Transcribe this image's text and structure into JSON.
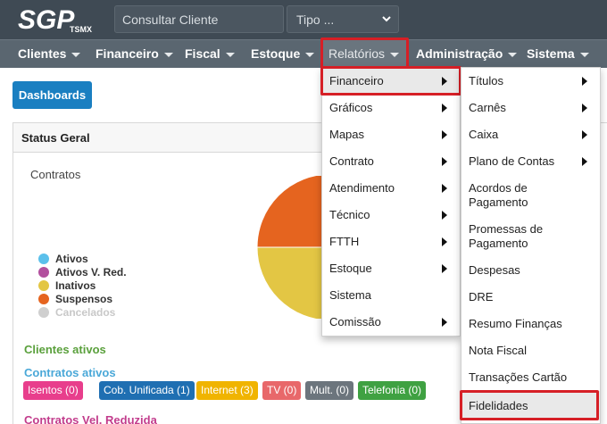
{
  "header": {
    "logo_text": "SGP",
    "logo_sub": "TSMX",
    "search_placeholder": "Consultar Cliente",
    "type_select_value": "Tipo ..."
  },
  "nav": [
    {
      "label": "Clientes"
    },
    {
      "label": "Financeiro"
    },
    {
      "label": "Fiscal"
    },
    {
      "label": "Estoque"
    },
    {
      "label": "Relatórios",
      "active": true
    },
    {
      "label": "Administração"
    },
    {
      "label": "Sistema"
    }
  ],
  "content": {
    "dashboards_button": "Dashboards",
    "panel_title": "Status Geral",
    "chart_title": "Contratos",
    "clientes_ativos": "Clientes ativos",
    "contratos_ativos": "Contratos ativos",
    "contratos_vel_reduzida": "Contratos Vel. Reduzida",
    "badges": [
      {
        "label": "Isentos (0)",
        "color": "#e83e8c"
      },
      {
        "label": "Cob. Unificada (1)",
        "color": "#1f6fb2"
      },
      {
        "label": "Internet (3)",
        "color": "#f0b400"
      },
      {
        "label": "TV (0)",
        "color": "#e8686a"
      },
      {
        "label": "Mult. (0)",
        "color": "#6c757d"
      },
      {
        "label": "Telefonia (0)",
        "color": "#3fa142"
      }
    ]
  },
  "chart_data": {
    "type": "pie",
    "title": "Contratos",
    "legend": [
      {
        "name": "Ativos",
        "color": "#5bc0eb"
      },
      {
        "name": "Ativos V. Red.",
        "color": "#b2509e"
      },
      {
        "name": "Inativos",
        "color": "#e3c644"
      },
      {
        "name": "Suspensos",
        "color": "#e5641f"
      },
      {
        "name": "Cancelados",
        "color": "#cfcfcf",
        "muted": true
      }
    ],
    "slices": [
      {
        "name": "Inativos",
        "value": 3,
        "color": "#e3c644"
      },
      {
        "name": "Suspensos",
        "value": 1,
        "color": "#e5641f"
      }
    ]
  },
  "menu_relatorios": [
    {
      "label": "Financeiro",
      "submenu": true,
      "hover": true
    },
    {
      "label": "Gráficos",
      "submenu": true
    },
    {
      "label": "Mapas",
      "submenu": true
    },
    {
      "label": "Contrato",
      "submenu": true
    },
    {
      "label": "Atendimento",
      "submenu": true
    },
    {
      "label": "Técnico",
      "submenu": true
    },
    {
      "label": "FTTH",
      "submenu": true
    },
    {
      "label": "Estoque",
      "submenu": true
    },
    {
      "label": "Sistema",
      "submenu": false
    },
    {
      "label": "Comissão",
      "submenu": true
    }
  ],
  "menu_financeiro": [
    {
      "label": "Títulos",
      "submenu": true
    },
    {
      "label": "Carnês",
      "submenu": true
    },
    {
      "label": "Caixa",
      "submenu": true
    },
    {
      "label": "Plano de Contas",
      "submenu": true
    },
    {
      "label": "Acordos de Pagamento",
      "submenu": false
    },
    {
      "label": "Promessas de Pagamento",
      "submenu": false
    },
    {
      "label": "Despesas",
      "submenu": false
    },
    {
      "label": "DRE",
      "submenu": false
    },
    {
      "label": "Resumo Finanças",
      "submenu": false
    },
    {
      "label": "Nota Fiscal",
      "submenu": false
    },
    {
      "label": "Transações Cartão",
      "submenu": false
    },
    {
      "label": "Fidelidades",
      "submenu": false,
      "hover": true
    }
  ],
  "accent": "#d61f26"
}
